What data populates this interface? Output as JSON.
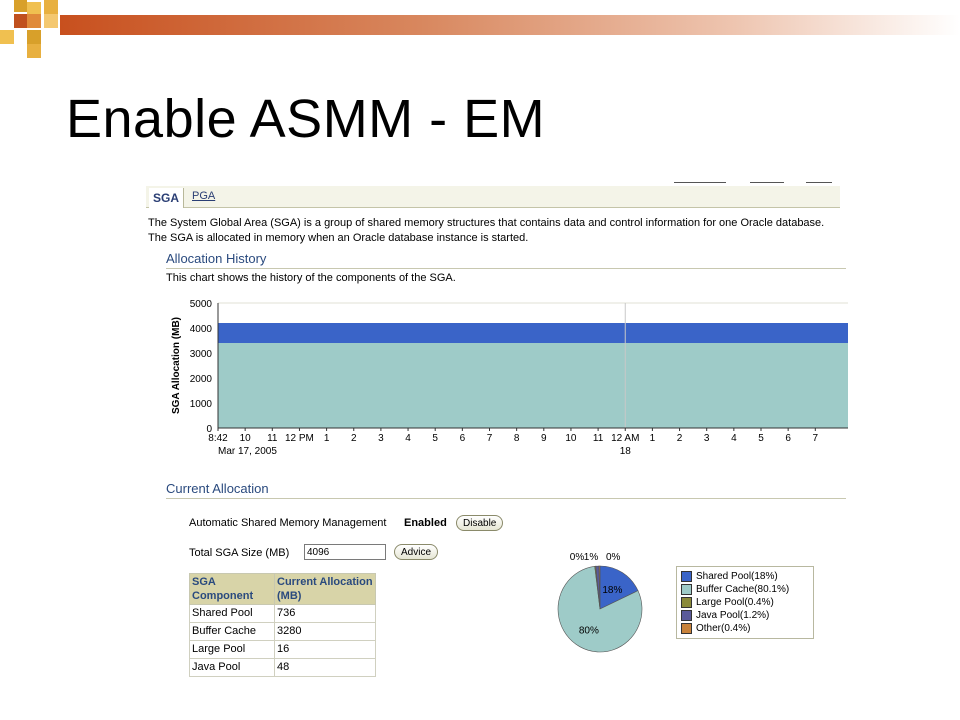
{
  "slide": {
    "title": "Enable ASMM - EM"
  },
  "tabs": {
    "sga": "SGA",
    "pga": "PGA"
  },
  "description": "The System Global Area (SGA) is a group of shared memory structures that contains data and control information for one Oracle database. The SGA is allocated in memory when an Oracle database instance is started.",
  "allocation_history": {
    "title": "Allocation History",
    "subtitle": "This chart shows the history of the components of the SGA."
  },
  "current_allocation": {
    "title": "Current Allocation",
    "asmm_label": "Automatic Shared Memory Management",
    "asmm_status": "Enabled",
    "disable_label": "Disable",
    "total_label": "Total SGA Size (MB)",
    "total_value": "4096",
    "advice_label": "Advice",
    "table": {
      "headers": [
        "SGA Component",
        "Current Allocation (MB)"
      ],
      "rows": [
        [
          "Shared Pool",
          "736"
        ],
        [
          "Buffer Cache",
          "3280"
        ],
        [
          "Large Pool",
          "16"
        ],
        [
          "Java Pool",
          "48"
        ]
      ]
    },
    "legend": [
      "Shared Pool(18%)",
      "Buffer Cache(80.1%)",
      "Large Pool(0.4%)",
      "Java Pool(1.2%)",
      "Other(0.4%)"
    ]
  },
  "colors": {
    "shared_pool": "#3a64c8",
    "buffer_cache": "#9ecbc8",
    "large_pool": "#8a8a3a",
    "java_pool": "#5a5a9a",
    "other": "#c8823a",
    "section_title": "#2a4a7e"
  },
  "chart_data": [
    {
      "type": "area",
      "ylabel": "SGA Allocation (MB)",
      "ylim": [
        0,
        5000
      ],
      "yticks": [
        0,
        1000,
        2000,
        3000,
        4000,
        5000
      ],
      "xtick_labels": [
        "8:42",
        "10",
        "11",
        "12 PM",
        "1",
        "2",
        "3",
        "4",
        "5",
        "6",
        "7",
        "8",
        "9",
        "10",
        "11",
        "12 AM",
        "1",
        "2",
        "3",
        "4",
        "5",
        "6",
        "7"
      ],
      "xdate_labels": [
        {
          "tick": 0,
          "text": "Mar 17, 2005"
        },
        {
          "tick": 15,
          "text": "18"
        }
      ],
      "grid": true,
      "series": [
        {
          "name": "Buffer Cache",
          "values": [
            3400,
            3400
          ]
        },
        {
          "name": "Shared Pool",
          "values": [
            800,
            800
          ]
        }
      ]
    },
    {
      "type": "pie",
      "slices": [
        {
          "name": "Shared Pool",
          "value": 18,
          "label": "18%"
        },
        {
          "name": "Buffer Cache",
          "value": 80.1,
          "label": "80%"
        },
        {
          "name": "Large Pool",
          "value": 0.4,
          "label": "0%"
        },
        {
          "name": "Java Pool",
          "value": 1.2,
          "label": "1%"
        },
        {
          "name": "Other",
          "value": 0.4,
          "label": "0%"
        }
      ]
    }
  ]
}
